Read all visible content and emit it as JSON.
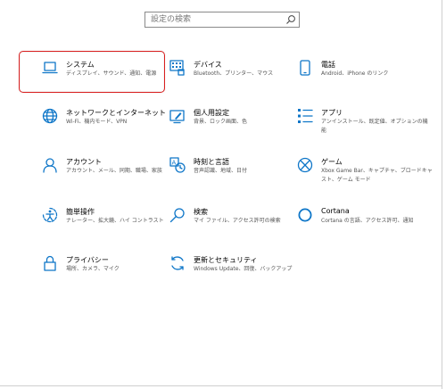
{
  "search": {
    "placeholder": "設定の検索"
  },
  "accent_color": "#0e76c8",
  "highlight_color": "#e02020",
  "tiles": [
    {
      "icon": "laptop-icon",
      "title": "システム",
      "desc": "ディスプレイ、サウンド、通知、電源"
    },
    {
      "icon": "keyboard-icon",
      "title": "デバイス",
      "desc": "Bluetooth、プリンター、マウス"
    },
    {
      "icon": "phone-icon",
      "title": "電話",
      "desc": "Android、iPhone のリンク"
    },
    {
      "icon": "globe-icon",
      "title": "ネットワークとインターネット",
      "desc": "Wi-Fi、機内モード、VPN"
    },
    {
      "icon": "personalization-icon",
      "title": "個人用設定",
      "desc": "背景、ロック画面、色"
    },
    {
      "icon": "apps-list-icon",
      "title": "アプリ",
      "desc": "アンインストール、既定値、オプションの機能"
    },
    {
      "icon": "person-icon",
      "title": "アカウント",
      "desc": "アカウント、メール、同期、職場、家族"
    },
    {
      "icon": "time-language-icon",
      "title": "時刻と言語",
      "desc": "音声認識、地域、日付"
    },
    {
      "icon": "xbox-icon",
      "title": "ゲーム",
      "desc": "Xbox Game Bar、キャプチャ、ブロードキャスト、ゲーム モード"
    },
    {
      "icon": "ease-of-access-icon",
      "title": "簡単操作",
      "desc": "ナレーター、拡大鏡、ハイ コントラスト"
    },
    {
      "icon": "search-icon",
      "title": "検索",
      "desc": "マイ ファイル、アクセス許可の検索"
    },
    {
      "icon": "cortana-icon",
      "title": "Cortana",
      "desc": "Cortana の言語、アクセス許可、通知"
    },
    {
      "icon": "lock-icon",
      "title": "プライバシー",
      "desc": "場所、カメラ、マイク"
    },
    {
      "icon": "sync-icon",
      "title": "更新とセキュリティ",
      "desc": "Windows Update、回復、バックアップ"
    }
  ]
}
